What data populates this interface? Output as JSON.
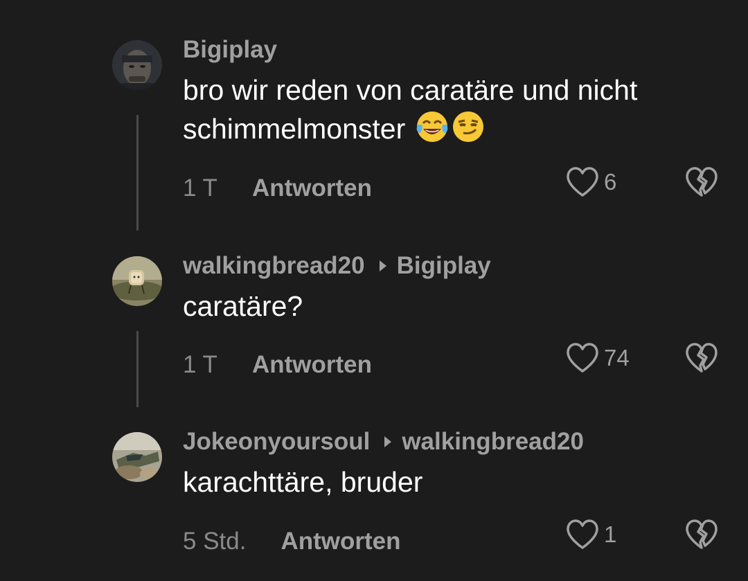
{
  "comments": [
    {
      "author": "Bigiplay",
      "reply_to": "",
      "text": "bro wir reden von caratäre und nicht schimmelmonster",
      "emojis": [
        "tears-of-joy-emoji",
        "smirking-face-emoji"
      ],
      "time": "1 T",
      "reply_label": "Antworten",
      "likes": "6"
    },
    {
      "author": "walkingbread20",
      "reply_to": "Bigiplay",
      "text": "caratäre?",
      "time": "1 T",
      "reply_label": "Antworten",
      "likes": "74"
    },
    {
      "author": "Jokeonyoursoul",
      "reply_to": "walkingbread20",
      "text": "karachttäre, bruder",
      "time": "5 Std.",
      "reply_label": "Antworten",
      "likes": "1"
    }
  ],
  "colors": {
    "background": "#1c1c1c",
    "username": "#a0a0a0",
    "text": "#ffffff",
    "timestamp": "#8a8a8a",
    "thread_line": "#4a4a4a"
  }
}
